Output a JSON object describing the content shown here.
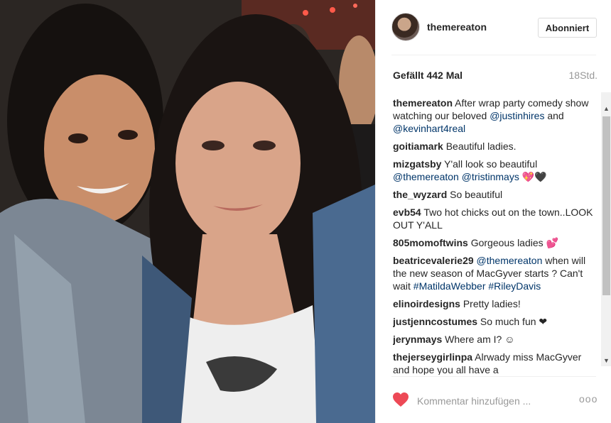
{
  "post": {
    "username": "themereaton",
    "follow_label": "Abonniert",
    "likes_text": "Gefällt 442 Mal",
    "time_text": "18Std.",
    "comments": [
      {
        "user": "themereaton",
        "parts": [
          {
            "t": "After wrap party comedy show watching our beloved "
          },
          {
            "m": "@justinhires"
          },
          {
            "t": " and "
          },
          {
            "m": "@kevinhart4real"
          }
        ]
      },
      {
        "user": "goitiamark",
        "parts": [
          {
            "t": "Beautiful ladies."
          }
        ]
      },
      {
        "user": "mizgatsby",
        "parts": [
          {
            "t": "Y'all look so beautiful "
          },
          {
            "m": "@themereaton"
          },
          {
            "t": " "
          },
          {
            "m": "@tristinmays"
          },
          {
            "t": " 💖🖤"
          }
        ]
      },
      {
        "user": "the_wyzard",
        "parts": [
          {
            "t": "So beautiful"
          }
        ]
      },
      {
        "user": "evb54",
        "parts": [
          {
            "t": "Two hot chicks out on the town..LOOK OUT Y'ALL"
          }
        ]
      },
      {
        "user": "805momoftwins",
        "parts": [
          {
            "t": "Gorgeous ladies 💕"
          }
        ]
      },
      {
        "user": "beatricevalerie29",
        "parts": [
          {
            "m": "@themereaton"
          },
          {
            "t": " when will the new season of MacGyver starts ? Can't wait "
          },
          {
            "m": "#MatildaWebber"
          },
          {
            "t": " "
          },
          {
            "m": "#RileyDavis"
          }
        ]
      },
      {
        "user": "elinoirdesigns",
        "parts": [
          {
            "t": "Pretty ladies!"
          }
        ]
      },
      {
        "user": "justjenncostumes",
        "parts": [
          {
            "t": "So much fun ❤"
          }
        ]
      },
      {
        "user": "jerynmays",
        "parts": [
          {
            "t": "Where am I? ☺"
          }
        ]
      },
      {
        "user": "thejerseygirlinpa",
        "parts": [
          {
            "t": "Alrwady miss MacGyver and hope you all have a"
          }
        ]
      }
    ],
    "comment_placeholder": "Kommentar hinzufügen ...",
    "more_label": "ooo"
  },
  "icons": {
    "like": "heart-icon",
    "options": "more-options-icon",
    "scroll_up": "scroll-up-arrow-icon",
    "scroll_down": "scroll-down-arrow-icon"
  },
  "colors": {
    "like_red": "#ed4956",
    "mention_blue": "#003569",
    "muted": "#999999"
  }
}
